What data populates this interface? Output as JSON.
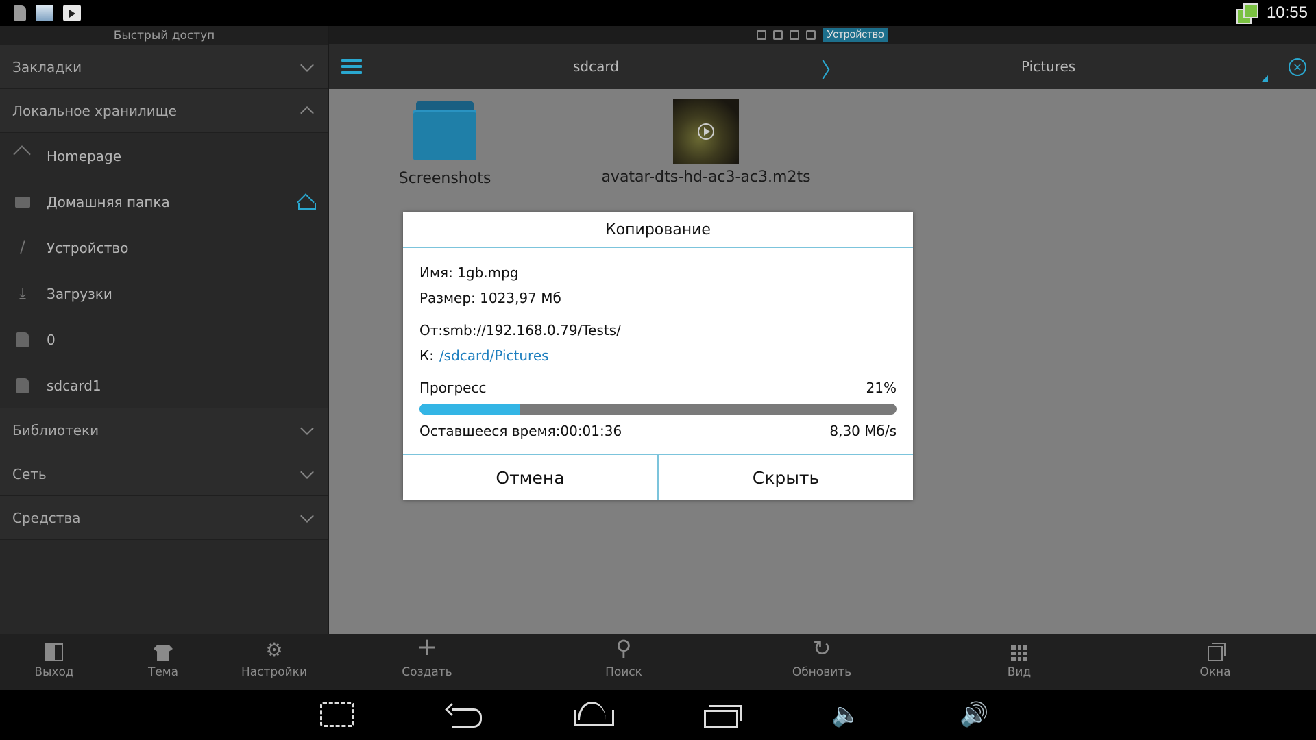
{
  "statusbar": {
    "left_icons": [
      "sd-card-icon",
      "gallery-icon",
      "play-store-icon"
    ],
    "time": "10:55"
  },
  "sidebar": {
    "quick_access": "Быстрый доступ",
    "sections": {
      "bookmarks": "Закладки",
      "local_storage": "Локальное хранилище",
      "libraries": "Библиотеки",
      "network": "Сеть",
      "tools": "Средства"
    },
    "items": [
      {
        "label": "Homepage",
        "icon": "home-icon"
      },
      {
        "label": "Домашняя папка",
        "icon": "folder-icon"
      },
      {
        "label": "Устройство",
        "icon": "slash-icon",
        "glyph": "/"
      },
      {
        "label": "Загрузки",
        "icon": "download-icon",
        "glyph": "⤓"
      },
      {
        "label": "0",
        "icon": "sd-icon"
      },
      {
        "label": "sdcard1",
        "icon": "sd-icon"
      }
    ]
  },
  "pathbar": {
    "device_label": "Устройство"
  },
  "toolbar": {
    "crumbs": [
      "sdcard",
      "Pictures"
    ],
    "separator": "〉",
    "close_glyph": "✕"
  },
  "files": [
    {
      "name": "Screenshots",
      "type": "folder"
    },
    {
      "name": "avatar-dts-hd-ac3-ac3.m2ts",
      "type": "video"
    }
  ],
  "dialog": {
    "title": "Копирование",
    "name_line": "Имя: 1gb.mpg",
    "size_line": "Размер: 1023,97 Мб",
    "from_line": "От:smb://192.168.0.79/Tests/",
    "to_label": "К:",
    "to_value": "/sdcard/Pictures",
    "progress_label": "Прогресс",
    "progress_percent_text": "21%",
    "progress_value": 0.21,
    "time_left": "Оставшееся время:00:01:36",
    "speed": "8,30 Мб/s",
    "cancel": "Отмена",
    "hide": "Скрыть",
    "accent_color": "#33b5e5"
  },
  "appbar": {
    "exit": "Выход",
    "theme": "Тема",
    "settings": "Настройки",
    "create": "Создать",
    "search": "Поиск",
    "refresh": "Обновить",
    "view": "Вид",
    "windows": "Окна",
    "glyphs": {
      "settings": "⚙",
      "create": "+",
      "search": "⚲",
      "refresh": "↻"
    }
  },
  "navbar": {
    "vol_down": "🔈",
    "vol_up": "🔊"
  }
}
